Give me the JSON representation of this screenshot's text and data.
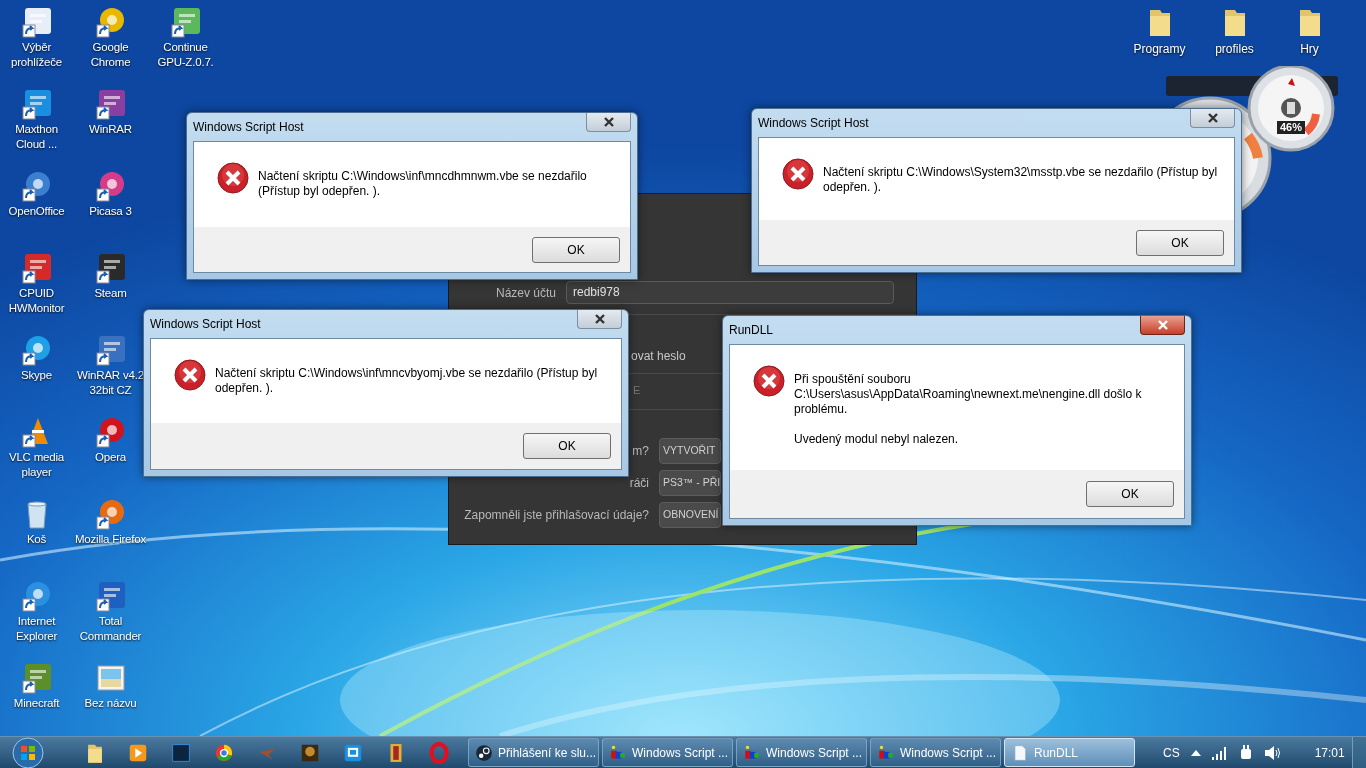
{
  "desktop_icons": {
    "columns": [
      [
        "Výběr prohlížeče",
        "Maxthon Cloud ...",
        "OpenOffice",
        "CPUID HWMonitor",
        "Skype",
        "VLC media player",
        "Koš",
        "Internet Explorer",
        "Minecraft"
      ],
      [
        "Google Chrome",
        "WinRAR",
        "Picasa 3",
        "Steam",
        "WinRAR v4.2 32bit CZ",
        "Opera",
        "Mozilla Firefox",
        "Total Commander",
        "Bez názvu"
      ],
      [
        "Continue GPU-Z.0.7."
      ]
    ]
  },
  "desktop_folders": [
    "Programy",
    "profiles",
    "Hry"
  ],
  "cpu_gadget": {
    "reading": "46%"
  },
  "steam_window": {
    "account": {
      "label": "Název účtu",
      "value": "redbi978"
    },
    "remember_fragment": "ovat heslo",
    "field_fragment": "E",
    "actions": [
      {
        "label": "m?",
        "button": "VYTVOŘIT"
      },
      {
        "label": "ráči",
        "button": "PS3™ - PŘI"
      },
      {
        "label": "Zapomněli jste přihlašovací údaje?",
        "button": "OBNOVENÍ"
      }
    ]
  },
  "dialogs": [
    {
      "title": "Windows Script Host",
      "message": [
        "Načtení skriptu C:\\Windows\\inf\\mncdhmnwm.vbe se nezdařilo (Přístup byl odepřen. )."
      ],
      "button": "OK",
      "active": false
    },
    {
      "title": "Windows Script Host",
      "message": [
        "Načtení skriptu C:\\Windows\\System32\\msstp.vbe se nezdařilo (Přístup byl odepřen. )."
      ],
      "button": "OK",
      "active": false
    },
    {
      "title": "Windows Script Host",
      "message": [
        "Načtení skriptu C:\\Windows\\inf\\mncvbyomj.vbe se nezdařilo (Přístup byl odepřen. )."
      ],
      "button": "OK",
      "active": false
    },
    {
      "title": "RunDLL",
      "message": [
        "Při spouštění souboru C:\\Users\\asus\\AppData\\Roaming\\newnext.me\\nengine.dll došlo k problému.",
        "Uvedený modul nebyl nalezen."
      ],
      "button": "OK",
      "active": true
    }
  ],
  "taskbar": {
    "tasks": [
      {
        "label": "Přihlášení ke slu...",
        "kind": "steam",
        "selected": false
      },
      {
        "label": "Windows Script ...",
        "kind": "script",
        "selected": false
      },
      {
        "label": "Windows Script ...",
        "kind": "script",
        "selected": false
      },
      {
        "label": "Windows Script ...",
        "kind": "script",
        "selected": false
      },
      {
        "label": "RunDLL",
        "kind": "document",
        "selected": true
      }
    ],
    "language": "CS",
    "clock": "17:01"
  }
}
